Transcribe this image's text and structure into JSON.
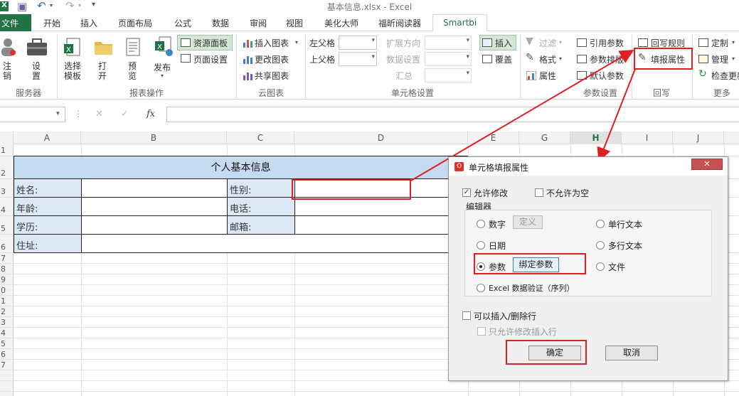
{
  "window": {
    "title": "基本信息.xlsx - Excel"
  },
  "tabs": [
    "文件",
    "开始",
    "插入",
    "页面布局",
    "公式",
    "数据",
    "审阅",
    "视图",
    "美化大师",
    "福昕阅读器",
    "Smartbi"
  ],
  "ribbon": {
    "server": {
      "logout_label": "注\n销",
      "settings_label": "设\n置",
      "group": "服务器"
    },
    "report": {
      "select_label": "选择\n模板",
      "open_label": "打\n开",
      "preview_label": "预\n览",
      "publish_label": "发布",
      "resource_panel": "资源面板",
      "page_setup": "页面设置",
      "group": "报表操作"
    },
    "cloud": {
      "insert_chart": "插入图表",
      "change_chart": "更改图表",
      "share_chart": "共享图表",
      "group": "云图表"
    },
    "cellset": {
      "left_parent": "左父格",
      "top_parent": "上父格",
      "expand_dir": "扩展方向",
      "data_setting": "数据设置",
      "summary": "汇总",
      "insert": "插入",
      "cover": "覆盖",
      "group": "单元格设置"
    },
    "paramset": {
      "filter": "过滤",
      "format": "格式",
      "property": "属性",
      "ref_param": "引用参数",
      "param_layout": "参数排版",
      "default_param": "默认参数",
      "group": "参数设置"
    },
    "writeback": {
      "rule": "回写规则",
      "fill_prop": "填报属性",
      "group": "回写"
    },
    "more": {
      "custom": "定制",
      "manage": "管理",
      "check_update": "检查更新",
      "group": "更多"
    }
  },
  "formula_bar": {
    "name_box": "",
    "fx": "fx",
    "cancel": "✕",
    "confirm": "✓",
    "value": ""
  },
  "sheet": {
    "columns": [
      "A",
      "B",
      "C",
      "D",
      "E",
      "G",
      "H",
      "I",
      "J"
    ],
    "rows": [
      "1",
      "2",
      "3",
      "4",
      "5",
      "6",
      "7",
      "8",
      "9",
      "0",
      "1",
      "2",
      "3",
      "4",
      "5",
      "6",
      "7"
    ],
    "table_title": "个人基本信息",
    "labels": {
      "name": "姓名:",
      "gender": "性别:",
      "age": "年龄:",
      "phone": "电话:",
      "education": "学历:",
      "email": "邮箱:",
      "address": "住址:"
    }
  },
  "dialog": {
    "title": "单元格填报属性",
    "close": "✕",
    "allow_edit": "允许修改",
    "not_empty": "不允许为空",
    "editor_group": "编辑器",
    "options": {
      "number": "数字",
      "define": "定义",
      "date": "日期",
      "param": "参数",
      "bind_param": "绑定参数",
      "excel_valid": "Excel 数据验证（序列）",
      "single_text": "单行文本",
      "multi_text": "多行文本",
      "file": "文件"
    },
    "insert_delete": "可以插入/删除行",
    "only_insert": "只允许修改插入行",
    "ok": "确定",
    "cancel": "取消"
  },
  "colors": {
    "excel_green": "#217346",
    "header_blue": "#dbe8f6",
    "title_blue": "#c4dbf0",
    "annotation_red": "#e02020"
  }
}
